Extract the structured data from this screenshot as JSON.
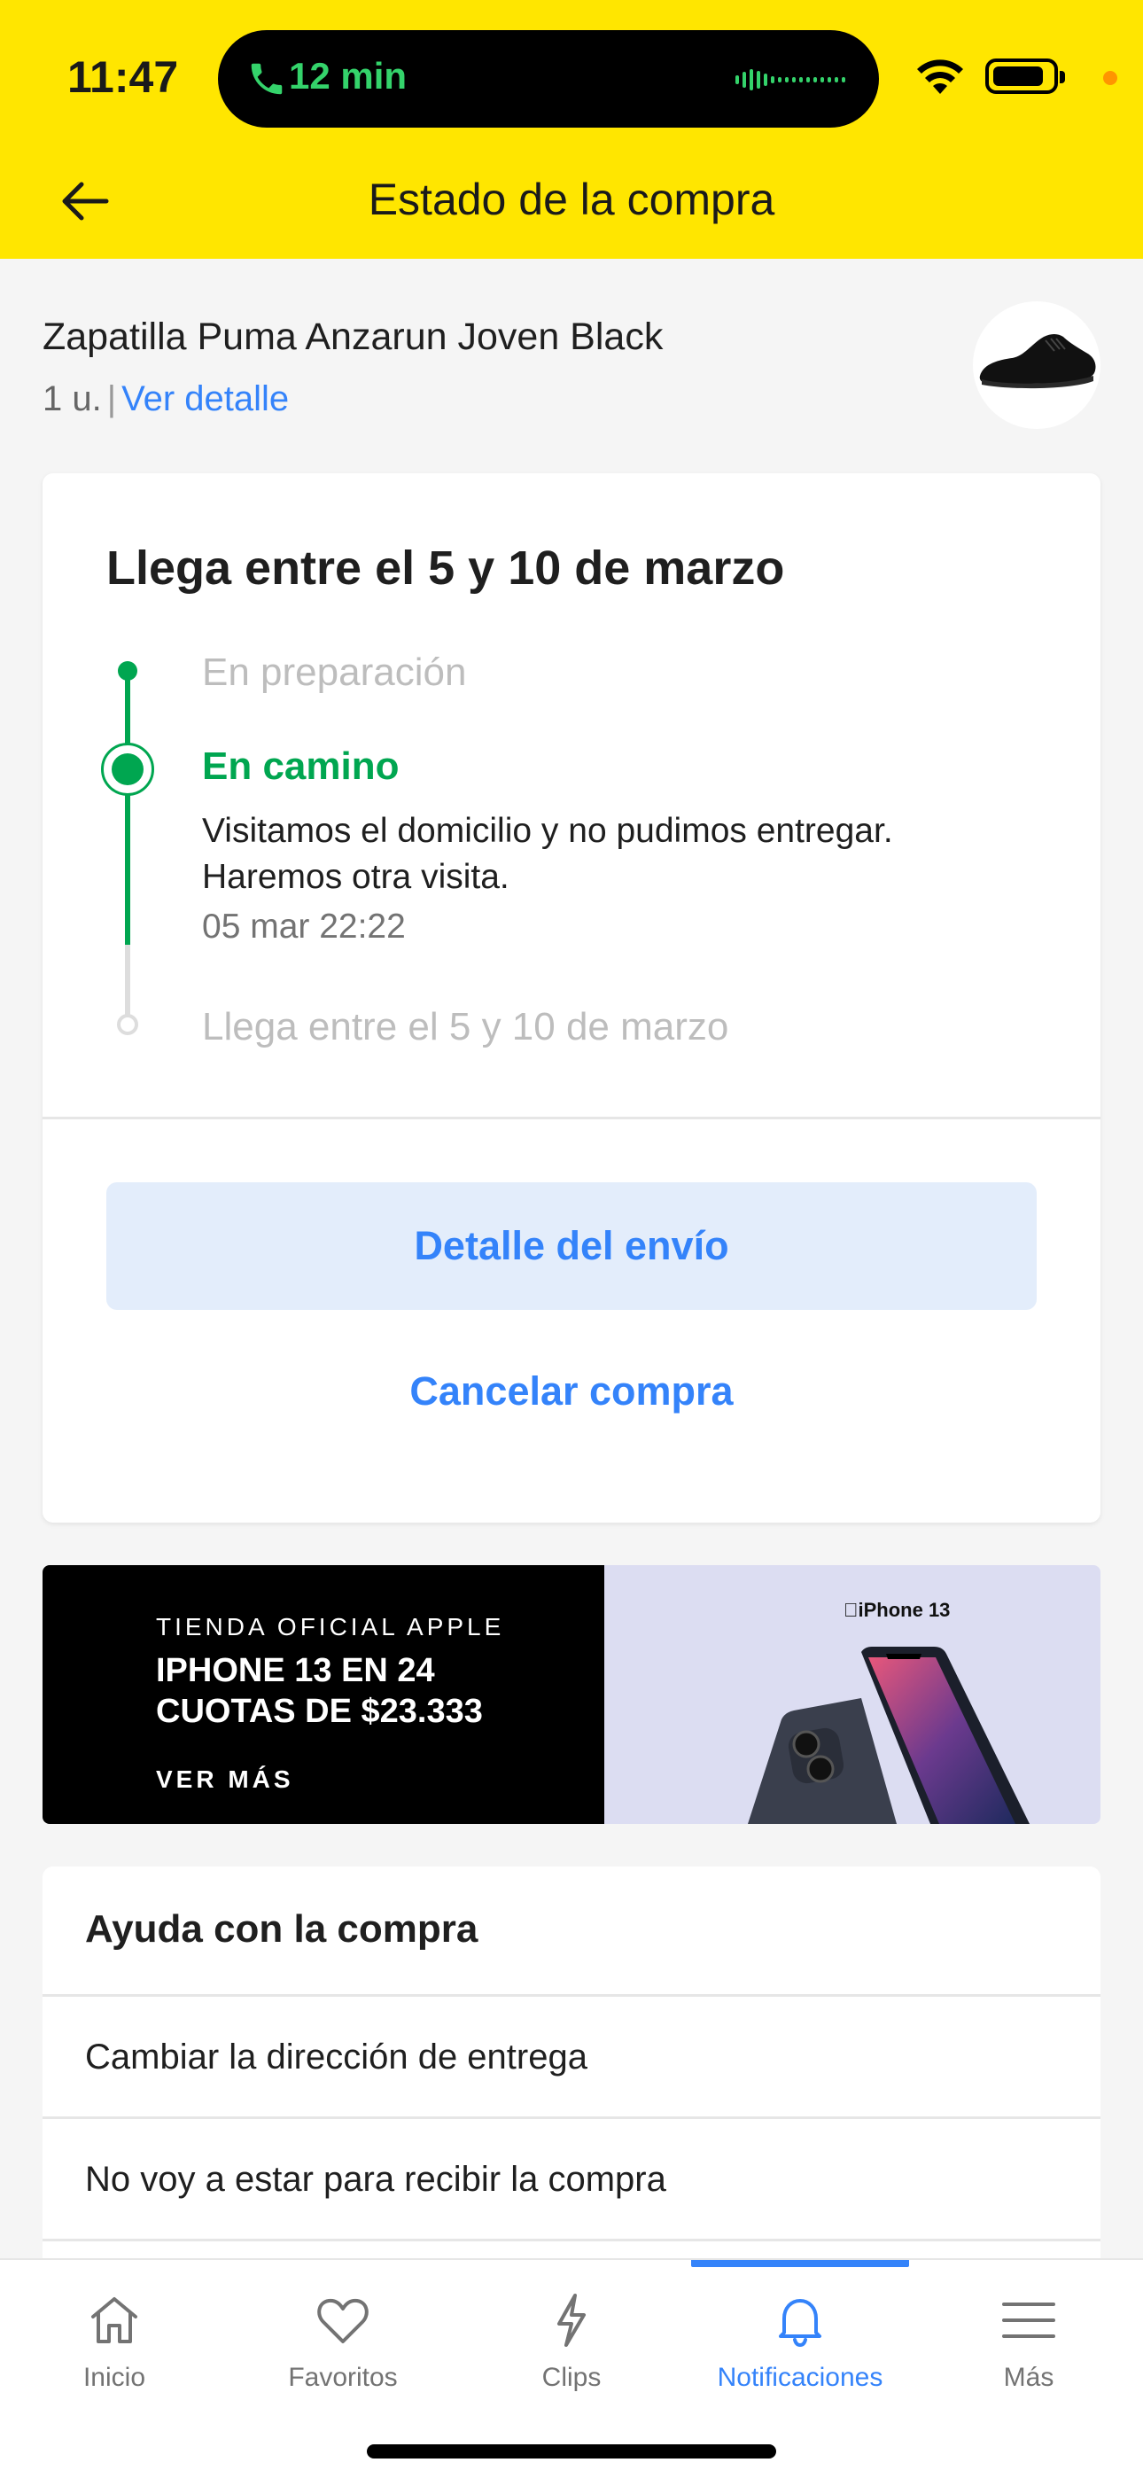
{
  "status_bar": {
    "time": "11:47",
    "call_duration": "12 min"
  },
  "header": {
    "title": "Estado de la compra"
  },
  "product": {
    "name": "Zapatilla Puma Anzarun Joven Black",
    "quantity": "1 u.",
    "separator": "|",
    "detail_link": "Ver detalle"
  },
  "shipment": {
    "arrival_title": "Llega entre el 5 y 10 de marzo",
    "steps": [
      {
        "label": "En preparación",
        "state": "done"
      },
      {
        "label": "En camino",
        "state": "current",
        "description": "Visitamos el domicilio y no pudimos entregar. Haremos otra visita.",
        "timestamp": "05 mar 22:22"
      },
      {
        "label": "Llega entre el 5 y 10 de marzo",
        "state": "pending"
      }
    ],
    "detail_button": "Detalle del envío",
    "cancel_button": "Cancelar compra"
  },
  "banner": {
    "eyebrow": "TIENDA OFICIAL APPLE",
    "headline": "IPHONE 13 EN 24 CUOTAS DE $23.333",
    "cta": "VER MÁS",
    "product_label": "iPhone 13"
  },
  "help": {
    "title": "Ayuda con la compra",
    "items": [
      "Cambiar la dirección de entrega",
      "No voy a estar para recibir la compra"
    ]
  },
  "tabbar": {
    "items": [
      {
        "label": "Inicio",
        "icon": "home-icon"
      },
      {
        "label": "Favoritos",
        "icon": "heart-icon"
      },
      {
        "label": "Clips",
        "icon": "lightning-icon"
      },
      {
        "label": "Notificaciones",
        "icon": "bell-icon",
        "active": true
      },
      {
        "label": "Más",
        "icon": "menu-icon"
      }
    ]
  },
  "colors": {
    "header_yellow": "#ffe600",
    "accent_blue": "#3483fa",
    "success_green": "#00a650"
  }
}
